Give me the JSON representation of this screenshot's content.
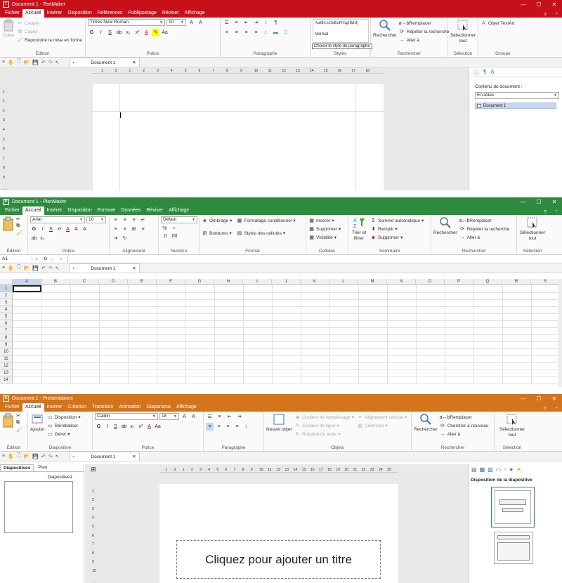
{
  "colors": {
    "textmaker": "#c8101a",
    "planmaker": "#2e8b3e",
    "presentations": "#d4731a"
  },
  "textmaker": {
    "title": "Document 1 - TextMaker",
    "icon_letter": "T",
    "tabs": [
      "Fichier",
      "Accueil",
      "Insérer",
      "Disposition",
      "Références",
      "Publipostage",
      "Réviser",
      "Affichage"
    ],
    "active_tab": "Accueil",
    "edition": {
      "label": "Édition",
      "paste": "Coller",
      "cut": "Couper",
      "copy": "Copier",
      "format_painter": "Reproduire la mise en forme"
    },
    "police": {
      "label": "Police",
      "font": "Times New Roman",
      "size": "10"
    },
    "paragraphe": {
      "label": "Paragraphe"
    },
    "styles": {
      "label": "Styles",
      "preview": "AaBbCcDdEeFfGgHhIiJj",
      "current": "Normal",
      "tooltip": "Choisir le style de paragraphe"
    },
    "rechercher": {
      "label": "Rechercher",
      "search": "Rechercher",
      "replace": "Remplacer",
      "repeat": "Répéter la recherche",
      "goto": "Aller à"
    },
    "selection": {
      "label": "Sélection",
      "select_all": "Sélectionner tout"
    },
    "groupe": {
      "label": "Groupe",
      "textart": "Objet TextArt"
    },
    "doc_tab": "Document 1",
    "ruler": [
      "1",
      "2",
      "1",
      "2",
      "3",
      "4",
      "5",
      "6",
      "7",
      "8",
      "9",
      "10",
      "11",
      "12",
      "13",
      "14",
      "15",
      "16",
      "17",
      "18"
    ],
    "vruler": [
      "1",
      "1",
      "2",
      "3",
      "4",
      "5",
      "6",
      "7",
      "8",
      "9"
    ],
    "sidebar": {
      "heading": "Contenu du document :",
      "select": "En-têtes",
      "item": "Document 1"
    }
  },
  "planmaker": {
    "title": "Document 1 - PlanMaker",
    "icon_letter": "P",
    "tabs": [
      "Fichier",
      "Accueil",
      "Insérer",
      "Disposition",
      "Formule",
      "Données",
      "Réviser",
      "Affichage"
    ],
    "active_tab": "Accueil",
    "edition": {
      "label": "Édition"
    },
    "police": {
      "label": "Police",
      "font": "Arial",
      "size": "10"
    },
    "alignement": {
      "label": "Alignement"
    },
    "numero": {
      "label": "Numéro",
      "format": "Défaut"
    },
    "format": {
      "label": "Format",
      "shading": "Ombrage",
      "borders": "Bordures",
      "cond_format": "Formatage conditionnel",
      "cell_styles": "Styles des cellules"
    },
    "cellules": {
      "label": "Cellules",
      "insert": "Insérer",
      "delete": "Supprimer",
      "visibility": "Visibilité"
    },
    "sommaire": {
      "label": "Sommaire",
      "sort": "Trier et filtrer",
      "autosum": "Somme automatique",
      "fill": "Remplir",
      "delete": "Supprimer"
    },
    "rechercher": {
      "label": "Rechercher",
      "search": "Rechercher",
      "replace": "Remplacer",
      "repeat": "Répéter la recherche",
      "goto": "Aller à"
    },
    "selection": {
      "label": "Sélection",
      "select_all": "Sélectionner tout"
    },
    "cell_ref": "A1",
    "fx": "fx",
    "doc_tab": "Document 1",
    "columns": [
      "A",
      "B",
      "C",
      "D",
      "E",
      "F",
      "G",
      "H",
      "I",
      "J",
      "K",
      "L",
      "M",
      "N",
      "O",
      "P",
      "Q",
      "R",
      "S"
    ],
    "rows": [
      "1",
      "2",
      "3",
      "4",
      "5",
      "6",
      "7",
      "8",
      "9",
      "10",
      "11",
      "12",
      "13",
      "14"
    ]
  },
  "presentations": {
    "title": "Document 1 - Presentations",
    "icon_letter": "S",
    "tabs": [
      "Fichier",
      "Accueil",
      "Insérer",
      "Création",
      "Transition",
      "Animation",
      "Diaporama",
      "Affichage"
    ],
    "active_tab": "Accueil",
    "edition": {
      "label": "Édition"
    },
    "diapositive": {
      "label": "Diapositive",
      "add": "Ajouter",
      "layout": "Disposition",
      "reset": "Réinitialiser",
      "manage": "Gérer"
    },
    "police": {
      "label": "Police",
      "font": "Calibri",
      "size": "18"
    },
    "paragraphe": {
      "label": "Paragraphe"
    },
    "objets": {
      "label": "Objets",
      "new_object": "Nouvel objet",
      "fill_color": "Couleur de remplissage",
      "line_color": "Couleur de ligne",
      "text_rotation": "Rotation du texte",
      "valign": "Alignement vertical",
      "columns": "Colonnes"
    },
    "rechercher": {
      "label": "Rechercher",
      "search": "Rechercher",
      "replace": "Remplacer",
      "search_new": "Chercher à nouveau",
      "goto": "Aller à"
    },
    "selection": {
      "label": "Sélection",
      "select_all": "Sélectionner tout"
    },
    "doc_tab": "Document 1",
    "left_tabs": [
      "Diapositives",
      "Plan"
    ],
    "slide_name": "Diapositive1",
    "ruler": [
      "1",
      "2",
      "1",
      "2",
      "3",
      "4",
      "5",
      "6",
      "7",
      "8",
      "9",
      "10",
      "11",
      "12",
      "13",
      "14",
      "15",
      "16",
      "17",
      "18",
      "19",
      "20",
      "21",
      "22",
      "23",
      "24",
      "25"
    ],
    "vruler": [
      "1",
      "2",
      "3",
      "4",
      "5",
      "6",
      "7",
      "8",
      "9",
      "10"
    ],
    "title_placeholder": "Cliquez pour ajouter un titre",
    "layout_heading": "Disposition de la diapositive"
  }
}
